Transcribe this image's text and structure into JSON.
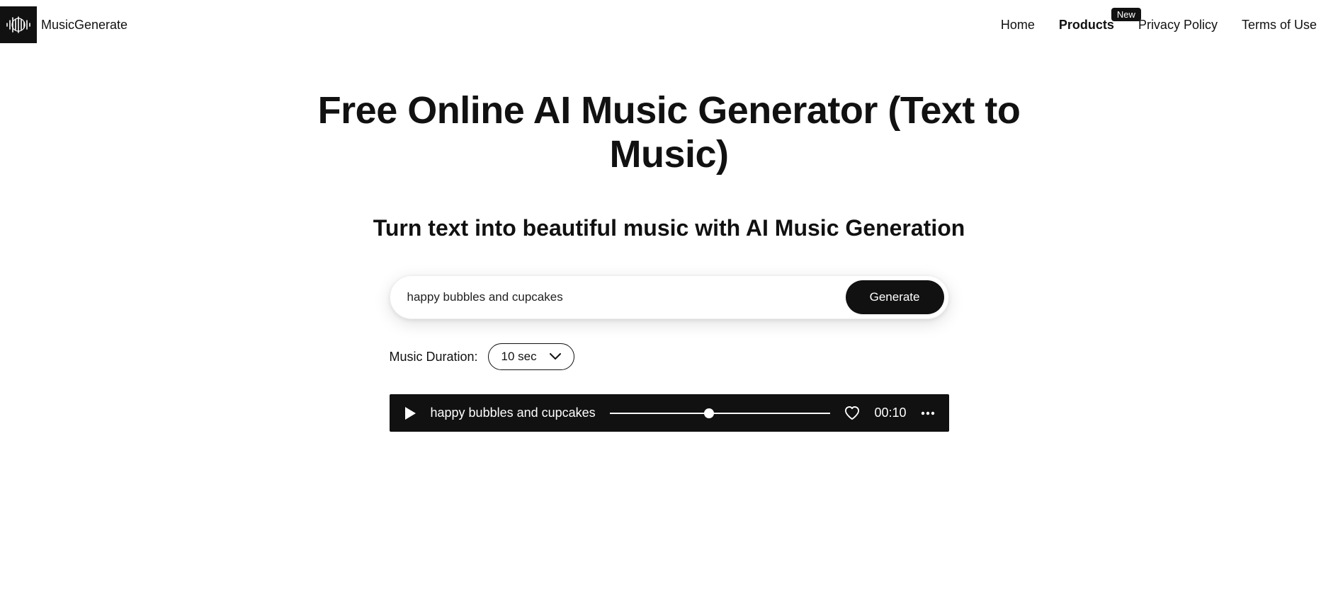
{
  "brand": {
    "name": "MusicGenerate"
  },
  "nav": {
    "home": "Home",
    "products": "Products",
    "products_badge": "New",
    "privacy": "Privacy Policy",
    "terms": "Terms of Use"
  },
  "hero": {
    "title": "Free Online AI Music Generator (Text to Music)",
    "subtitle": "Turn text into beautiful music with AI Music Generation"
  },
  "form": {
    "prompt_value": "happy bubbles and cupcakes",
    "generate_label": "Generate",
    "duration_label": "Music Duration:",
    "duration_value": "10 sec"
  },
  "player": {
    "track_name": "happy bubbles and cupcakes",
    "time": "00:10",
    "progress_percent": 45
  }
}
